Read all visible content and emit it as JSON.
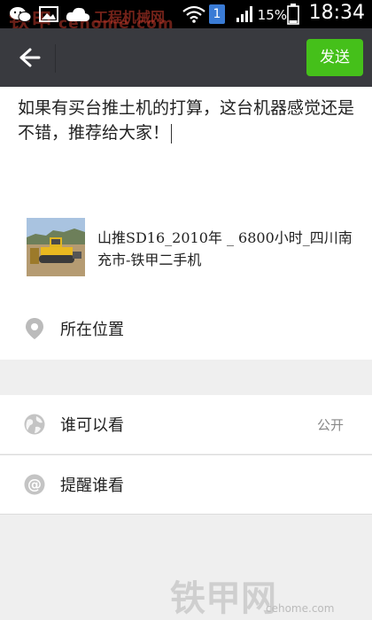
{
  "status_bar": {
    "time": "18:34",
    "battery_percent": "15%",
    "sim_badge": "1",
    "watermark": "铁甲",
    "watermark_domain": "cehome.com",
    "watermark_overlay": "工程机械网",
    "icons": [
      "wechat-icon",
      "image-icon",
      "cloud-icon",
      "wifi-icon",
      "sim-icon",
      "signal-icon",
      "battery-icon"
    ]
  },
  "header": {
    "back_icon": "back-arrow-icon",
    "send_label": "发送",
    "send_color": "#45c01a"
  },
  "compose": {
    "text": "如果有买台推土机的打算，这台机器感觉还是不错，推荐给大家！"
  },
  "link_card": {
    "title": "山推SD16_2010年 _ 6800小时_四川南充市-铁甲二手机"
  },
  "options": {
    "location_label": "所在位置",
    "visibility_label": "谁可以看",
    "visibility_value": "公开",
    "mention_label": "提醒谁看"
  },
  "watermark": {
    "text": "铁甲网",
    "domain": "cehome.com"
  }
}
